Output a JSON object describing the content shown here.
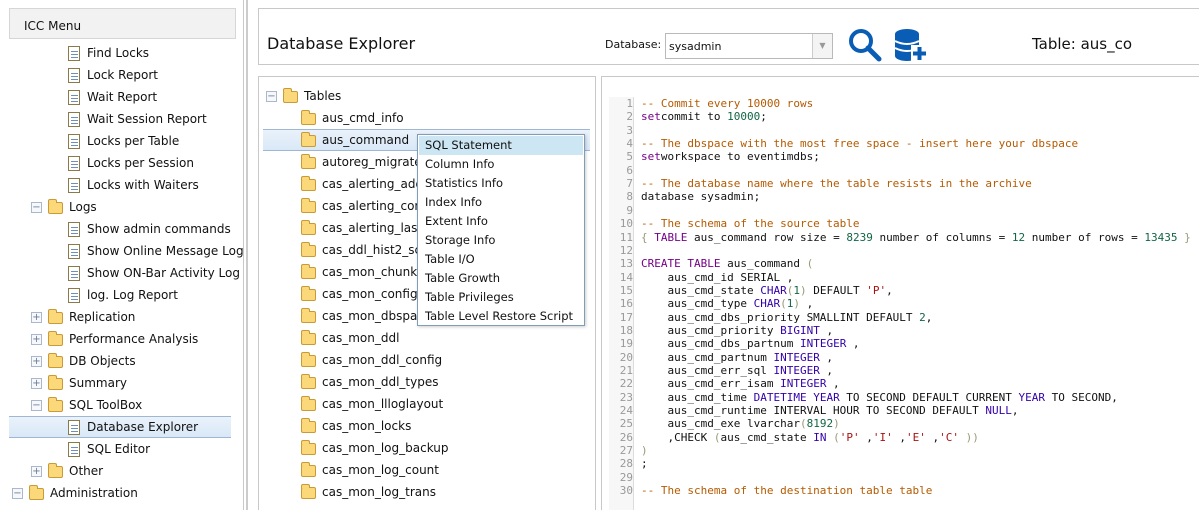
{
  "menu": {
    "title": "ICC Menu",
    "items": [
      {
        "label": "Find Locks",
        "kind": "doc",
        "level": 2
      },
      {
        "label": "Lock Report",
        "kind": "doc",
        "level": 2
      },
      {
        "label": "Wait Report",
        "kind": "doc",
        "level": 2
      },
      {
        "label": "Wait Session Report",
        "kind": "doc",
        "level": 2
      },
      {
        "label": "Locks per Table",
        "kind": "doc",
        "level": 2
      },
      {
        "label": "Locks per Session",
        "kind": "doc",
        "level": 2
      },
      {
        "label": "Locks with Waiters",
        "kind": "doc",
        "level": 2
      },
      {
        "label": "Logs",
        "kind": "folder",
        "level": 1,
        "expanded": true
      },
      {
        "label": "Show admin commands",
        "kind": "doc",
        "level": 2
      },
      {
        "label": "Show Online Message Log",
        "kind": "doc",
        "level": 2
      },
      {
        "label": "Show ON-Bar Activity Log",
        "kind": "doc",
        "level": 2
      },
      {
        "label": "log. Log Report",
        "kind": "doc",
        "level": 2
      },
      {
        "label": "Replication",
        "kind": "folder",
        "level": 1,
        "expanded": false
      },
      {
        "label": "Performance Analysis",
        "kind": "folder",
        "level": 1,
        "expanded": false
      },
      {
        "label": "DB Objects",
        "kind": "folder",
        "level": 1,
        "expanded": false
      },
      {
        "label": "Summary",
        "kind": "folder",
        "level": 1,
        "expanded": false
      },
      {
        "label": "SQL ToolBox",
        "kind": "folder",
        "level": 1,
        "expanded": true
      },
      {
        "label": "Database Explorer",
        "kind": "doc",
        "level": 2,
        "selected": true
      },
      {
        "label": "SQL Editor",
        "kind": "doc",
        "level": 2
      },
      {
        "label": "Other",
        "kind": "folder",
        "level": 1,
        "expanded": false
      },
      {
        "label": "Administration",
        "kind": "folder",
        "level": 0,
        "expanded": true
      }
    ]
  },
  "header": {
    "title": "Database Explorer",
    "database_label": "Database:",
    "database_value": "sysadmin",
    "table_label": "Table: aus_co"
  },
  "tree": {
    "root": "Tables",
    "tables": [
      "aus_cmd_info",
      "aus_command",
      "autoreg_migrate",
      "cas_alerting_add",
      "cas_alerting_conf",
      "cas_alerting_lastv",
      "cas_ddl_hist2_sc",
      "cas_mon_chunkla",
      "cas_mon_config",
      "cas_mon_dbspac",
      "cas_mon_ddl",
      "cas_mon_ddl_config",
      "cas_mon_ddl_types",
      "cas_mon_llloglayout",
      "cas_mon_locks",
      "cas_mon_log_backup",
      "cas_mon_log_count",
      "cas_mon_log_trans"
    ],
    "selected": "aus_command"
  },
  "context_menu": {
    "items": [
      "SQL Statement",
      "Column Info",
      "Statistics Info",
      "Index Info",
      "Extent Info",
      "Storage Info",
      "Table I/O",
      "Table Growth",
      "Table Privileges",
      "Table Level Restore Script"
    ],
    "highlighted": "SQL Statement"
  },
  "code": [
    [
      [
        "c",
        "-- Commit every 10000 rows"
      ]
    ],
    [
      [
        "k",
        "set"
      ],
      [
        "",
        "commit to "
      ],
      [
        "n",
        "10000"
      ],
      [
        "",
        ";"
      ]
    ],
    [],
    [
      [
        "c",
        "-- The dbspace with the most free space - insert here your dbspace"
      ]
    ],
    [
      [
        "k",
        "set"
      ],
      [
        "",
        "workspace to eventimdbs;"
      ]
    ],
    [],
    [
      [
        "c",
        "-- The database name where the table resists in the archive"
      ]
    ],
    [
      [
        "",
        "database sysadmin;"
      ]
    ],
    [],
    [
      [
        "c",
        "-- The schema of the source table"
      ]
    ],
    [
      [
        "b",
        "{"
      ],
      [
        "k",
        " TABLE"
      ],
      [
        "",
        " aus_command row size = "
      ],
      [
        "n",
        "8239"
      ],
      [
        "",
        " number of columns = "
      ],
      [
        "n",
        "12"
      ],
      [
        "",
        " number of rows = "
      ],
      [
        "n",
        "13435"
      ],
      [
        "b",
        " }"
      ]
    ],
    [],
    [
      [
        "k",
        "CREATE TABLE"
      ],
      [
        "",
        " aus_command "
      ],
      [
        "b",
        "("
      ]
    ],
    [
      [
        "",
        "    aus_cmd_id SERIAL ,"
      ]
    ],
    [
      [
        "",
        "    aus_cmd_state "
      ],
      [
        "t",
        "CHAR"
      ],
      [
        "b",
        "("
      ],
      [
        "n",
        "1"
      ],
      [
        "b",
        ")"
      ],
      [
        "",
        " DEFAULT "
      ],
      [
        "s",
        "'P'"
      ],
      [
        "",
        ","
      ]
    ],
    [
      [
        "",
        "    aus_cmd_type "
      ],
      [
        "t",
        "CHAR"
      ],
      [
        "b",
        "("
      ],
      [
        "n",
        "1"
      ],
      [
        "b",
        ")"
      ],
      [
        "",
        " ,"
      ]
    ],
    [
      [
        "",
        "    aus_cmd_dbs_priority SMALLINT DEFAULT "
      ],
      [
        "n",
        "2"
      ],
      [
        "",
        ","
      ]
    ],
    [
      [
        "",
        "    aus_cmd_priority "
      ],
      [
        "t",
        "BIGINT"
      ],
      [
        "",
        " ,"
      ]
    ],
    [
      [
        "",
        "    aus_cmd_dbs_partnum "
      ],
      [
        "t",
        "INTEGER"
      ],
      [
        "",
        " ,"
      ]
    ],
    [
      [
        "",
        "    aus_cmd_partnum "
      ],
      [
        "t",
        "INTEGER"
      ],
      [
        "",
        " ,"
      ]
    ],
    [
      [
        "",
        "    aus_cmd_err_sql "
      ],
      [
        "t",
        "INTEGER"
      ],
      [
        "",
        " ,"
      ]
    ],
    [
      [
        "",
        "    aus_cmd_err_isam "
      ],
      [
        "t",
        "INTEGER"
      ],
      [
        "",
        " ,"
      ]
    ],
    [
      [
        "",
        "    aus_cmd_time "
      ],
      [
        "t",
        "DATETIME YEAR"
      ],
      [
        "",
        " TO SECOND DEFAULT CURRENT "
      ],
      [
        "t",
        "YEAR"
      ],
      [
        "",
        " TO SECOND,"
      ]
    ],
    [
      [
        "",
        "    aus_cmd_runtime INTERVAL HOUR TO SECOND DEFAULT "
      ],
      [
        "t",
        "NULL"
      ],
      [
        "",
        ","
      ]
    ],
    [
      [
        "",
        "    aus_cmd_exe lvarchar"
      ],
      [
        "b",
        "("
      ],
      [
        "n",
        "8192"
      ],
      [
        "b",
        ")"
      ]
    ],
    [
      [
        "",
        "    ,CHECK "
      ],
      [
        "b",
        "("
      ],
      [
        "",
        "aus_cmd_state "
      ],
      [
        "t",
        "IN"
      ],
      [
        "b",
        " ("
      ],
      [
        "s",
        "'P'"
      ],
      [
        "",
        " ,"
      ],
      [
        "s",
        "'I'"
      ],
      [
        "",
        " ,"
      ],
      [
        "s",
        "'E'"
      ],
      [
        "",
        " ,"
      ],
      [
        "s",
        "'C'"
      ],
      [
        "b",
        " ))"
      ]
    ],
    [
      [
        "b",
        ")"
      ]
    ],
    [
      [
        "",
        ";"
      ]
    ],
    [],
    [
      [
        "c",
        "-- The schema of the destination table table"
      ]
    ]
  ]
}
